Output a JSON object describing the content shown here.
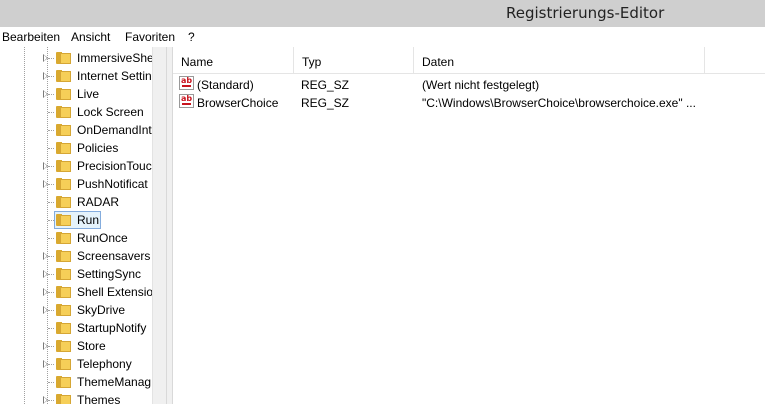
{
  "window": {
    "title": "Registrierungs-Editor"
  },
  "menu": [
    "Bearbeiten",
    "Ansicht",
    "Favoriten",
    "?"
  ],
  "tree": {
    "items": [
      {
        "label": "ImmersiveShe",
        "expandable": true
      },
      {
        "label": "Internet Settin",
        "expandable": true
      },
      {
        "label": "Live",
        "expandable": true
      },
      {
        "label": "Lock Screen",
        "expandable": false
      },
      {
        "label": "OnDemandInt",
        "expandable": false
      },
      {
        "label": "Policies",
        "expandable": false
      },
      {
        "label": "PrecisionTouc",
        "expandable": true
      },
      {
        "label": "PushNotificat",
        "expandable": true
      },
      {
        "label": "RADAR",
        "expandable": false
      },
      {
        "label": "Run",
        "expandable": false,
        "selected": true
      },
      {
        "label": "RunOnce",
        "expandable": false
      },
      {
        "label": "Screensavers",
        "expandable": true
      },
      {
        "label": "SettingSync",
        "expandable": true
      },
      {
        "label": "Shell Extension",
        "expandable": true
      },
      {
        "label": "SkyDrive",
        "expandable": true
      },
      {
        "label": "StartupNotify",
        "expandable": false
      },
      {
        "label": "Store",
        "expandable": true
      },
      {
        "label": "Telephony",
        "expandable": true
      },
      {
        "label": "ThemeManag",
        "expandable": false
      },
      {
        "label": "Themes",
        "expandable": true
      }
    ]
  },
  "list": {
    "columns": [
      "Name",
      "Typ",
      "Daten"
    ],
    "rows": [
      {
        "name": "(Standard)",
        "type": "REG_SZ",
        "data": "(Wert nicht festgelegt)",
        "icon": "string-value-icon"
      },
      {
        "name": "BrowserChoice",
        "type": "REG_SZ",
        "data": "\"C:\\Windows\\BrowserChoice\\browserchoice.exe\" ...",
        "icon": "string-value-icon"
      }
    ]
  }
}
